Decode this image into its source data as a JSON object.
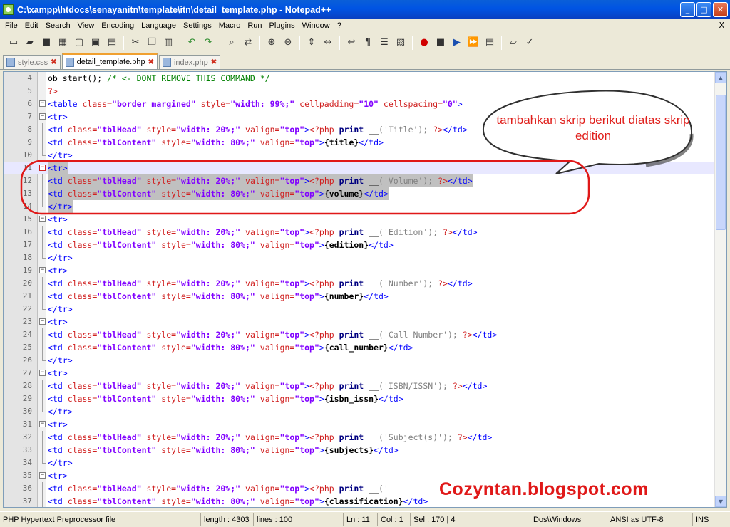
{
  "window": {
    "title": "C:\\xampp\\htdocs\\senayanitn\\template\\itn\\detail_template.php - Notepad++",
    "buttons": {
      "minimize": "_",
      "maximize": "□",
      "close": "✕"
    }
  },
  "menu": [
    "File",
    "Edit",
    "Search",
    "View",
    "Encoding",
    "Language",
    "Settings",
    "Macro",
    "Run",
    "Plugins",
    "Window",
    "?"
  ],
  "menu_close": "X",
  "toolbar": {
    "icons": [
      "new-file-icon",
      "open-file-icon",
      "save-icon",
      "save-all-icon",
      "close-file-icon",
      "close-all-icon",
      "print-icon",
      "cut-icon",
      "copy-icon",
      "paste-icon",
      "undo-icon",
      "redo-icon",
      "find-icon",
      "replace-icon",
      "zoom-in-icon",
      "zoom-out-icon",
      "sync-vertical-icon",
      "sync-horizontal-icon",
      "word-wrap-icon",
      "show-all-chars-icon",
      "indent-guide-icon",
      "user-defined-lang-icon",
      "record-macro-icon",
      "stop-record-icon",
      "playback-macro-icon",
      "run-macro-multiple-icon",
      "save-macro-icon",
      "open-folder-icon",
      "spell-check-icon"
    ]
  },
  "tabs": [
    {
      "label": "style.css",
      "active": false
    },
    {
      "label": "detail_template.php",
      "active": true
    },
    {
      "label": "index.php",
      "active": false
    }
  ],
  "editor": {
    "lines": [
      {
        "n": "4",
        "text": "ob_start(); /* <- DONT REMOVE THIS COMMAND */"
      },
      {
        "n": "5",
        "text": "?>"
      },
      {
        "n": "6",
        "text": "<table class=\"border margined\" style=\"width: 99%;\" cellpadding=\"10\" cellspacing=\"0\">"
      },
      {
        "n": "7",
        "text": "<tr>"
      },
      {
        "n": "8",
        "text": "<td class=\"tblHead\" style=\"width: 20%;\" valign=\"top\"><?php print __('Title'); ?></td>"
      },
      {
        "n": "9",
        "text": "<td class=\"tblContent\" style=\"width: 80%;\" valign=\"top\">{title}</td>"
      },
      {
        "n": "10",
        "text": "</tr>"
      },
      {
        "n": "11",
        "text": "<tr>"
      },
      {
        "n": "12",
        "text": "<td class=\"tblHead\" style=\"width: 20%;\" valign=\"top\"><?php print __('Volume'); ?></td>"
      },
      {
        "n": "13",
        "text": "<td class=\"tblContent\" style=\"width: 80%;\" valign=\"top\">{volume}</td>"
      },
      {
        "n": "14",
        "text": "</tr>"
      },
      {
        "n": "15",
        "text": "<tr>"
      },
      {
        "n": "16",
        "text": "<td class=\"tblHead\" style=\"width: 20%;\" valign=\"top\"><?php print __('Edition'); ?></td>"
      },
      {
        "n": "17",
        "text": "<td class=\"tblContent\" style=\"width: 80%;\" valign=\"top\">{edition}</td>"
      },
      {
        "n": "18",
        "text": "</tr>"
      },
      {
        "n": "19",
        "text": "<tr>"
      },
      {
        "n": "20",
        "text": "<td class=\"tblHead\" style=\"width: 20%;\" valign=\"top\"><?php print __('Number'); ?></td>"
      },
      {
        "n": "21",
        "text": "<td class=\"tblContent\" style=\"width: 80%;\" valign=\"top\">{number}</td>"
      },
      {
        "n": "22",
        "text": "</tr>"
      },
      {
        "n": "23",
        "text": "<tr>"
      },
      {
        "n": "24",
        "text": "<td class=\"tblHead\" style=\"width: 20%;\" valign=\"top\"><?php print __('Call Number'); ?></td>"
      },
      {
        "n": "25",
        "text": "<td class=\"tblContent\" style=\"width: 80%;\" valign=\"top\">{call_number}</td>"
      },
      {
        "n": "26",
        "text": "</tr>"
      },
      {
        "n": "27",
        "text": "<tr>"
      },
      {
        "n": "28",
        "text": "<td class=\"tblHead\" style=\"width: 20%;\" valign=\"top\"><?php print __('ISBN/ISSN'); ?></td>"
      },
      {
        "n": "29",
        "text": "<td class=\"tblContent\" style=\"width: 80%;\" valign=\"top\">{isbn_issn}</td>"
      },
      {
        "n": "30",
        "text": "</tr>"
      },
      {
        "n": "31",
        "text": "<tr>"
      },
      {
        "n": "32",
        "text": "<td class=\"tblHead\" style=\"width: 20%;\" valign=\"top\"><?php print __('Subject(s)'); ?></td>"
      },
      {
        "n": "33",
        "text": "<td class=\"tblContent\" style=\"width: 80%;\" valign=\"top\">{subjects}</td>"
      },
      {
        "n": "34",
        "text": "</tr>"
      },
      {
        "n": "35",
        "text": "<tr>"
      },
      {
        "n": "36",
        "text": "<td class=\"tblHead\" style=\"width: 20%;\" valign=\"top\"><?php print __('"
      },
      {
        "n": "37",
        "text": "<td class=\"tblContent\" style=\"width: 80%;\" valign=\"top\">{classification}</td>"
      }
    ],
    "selected_lines": [
      "11",
      "12",
      "13",
      "14"
    ],
    "caret_line": "11"
  },
  "annotation": {
    "callout_text": "tambahkan skrip berikut diatas skrip edition",
    "watermark": "Cozyntan.blogspot.com",
    "color": "#e0201c"
  },
  "status": {
    "file_type": "PHP Hypertext Preprocessor file",
    "length": "length : 4303",
    "lines": "lines : 100",
    "ln": "Ln : 11",
    "col": "Col : 1",
    "sel": "Sel : 170 | 4",
    "eol": "Dos\\Windows",
    "encoding": "ANSI as UTF-8",
    "mode": "INS"
  }
}
